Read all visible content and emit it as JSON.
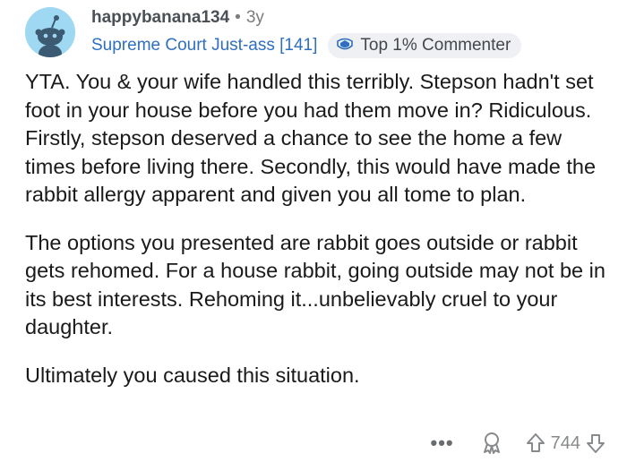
{
  "comment": {
    "username": "happybanana134",
    "separator": "•",
    "age": "3y",
    "user_flair": "Supreme Court Just-ass [141]",
    "badge": {
      "label": "Top 1% Commenter",
      "icon": "top-commenter-icon"
    },
    "avatar_color": "#9fd8f2",
    "paragraphs": [
      "YTA. You & your wife handled this terribly. Stepson hadn't set foot in your house before you had them move in? Ridiculous. Firstly, stepson deserved a chance to see the home a few times before living there. Secondly, this would have made the rabbit allergy apparent and given you all tome to plan.",
      "The options you presented are rabbit goes outside or rabbit gets rehomed. For a house rabbit, going outside may not be in its best interests. Rehoming it...unbelievably cruel to your daughter.",
      "Ultimately you caused this situation."
    ],
    "actions": {
      "more": "•••",
      "award_icon": "award-icon",
      "upvote_icon": "upvote-icon",
      "score": "744",
      "downvote_icon": "downvote-icon"
    }
  }
}
